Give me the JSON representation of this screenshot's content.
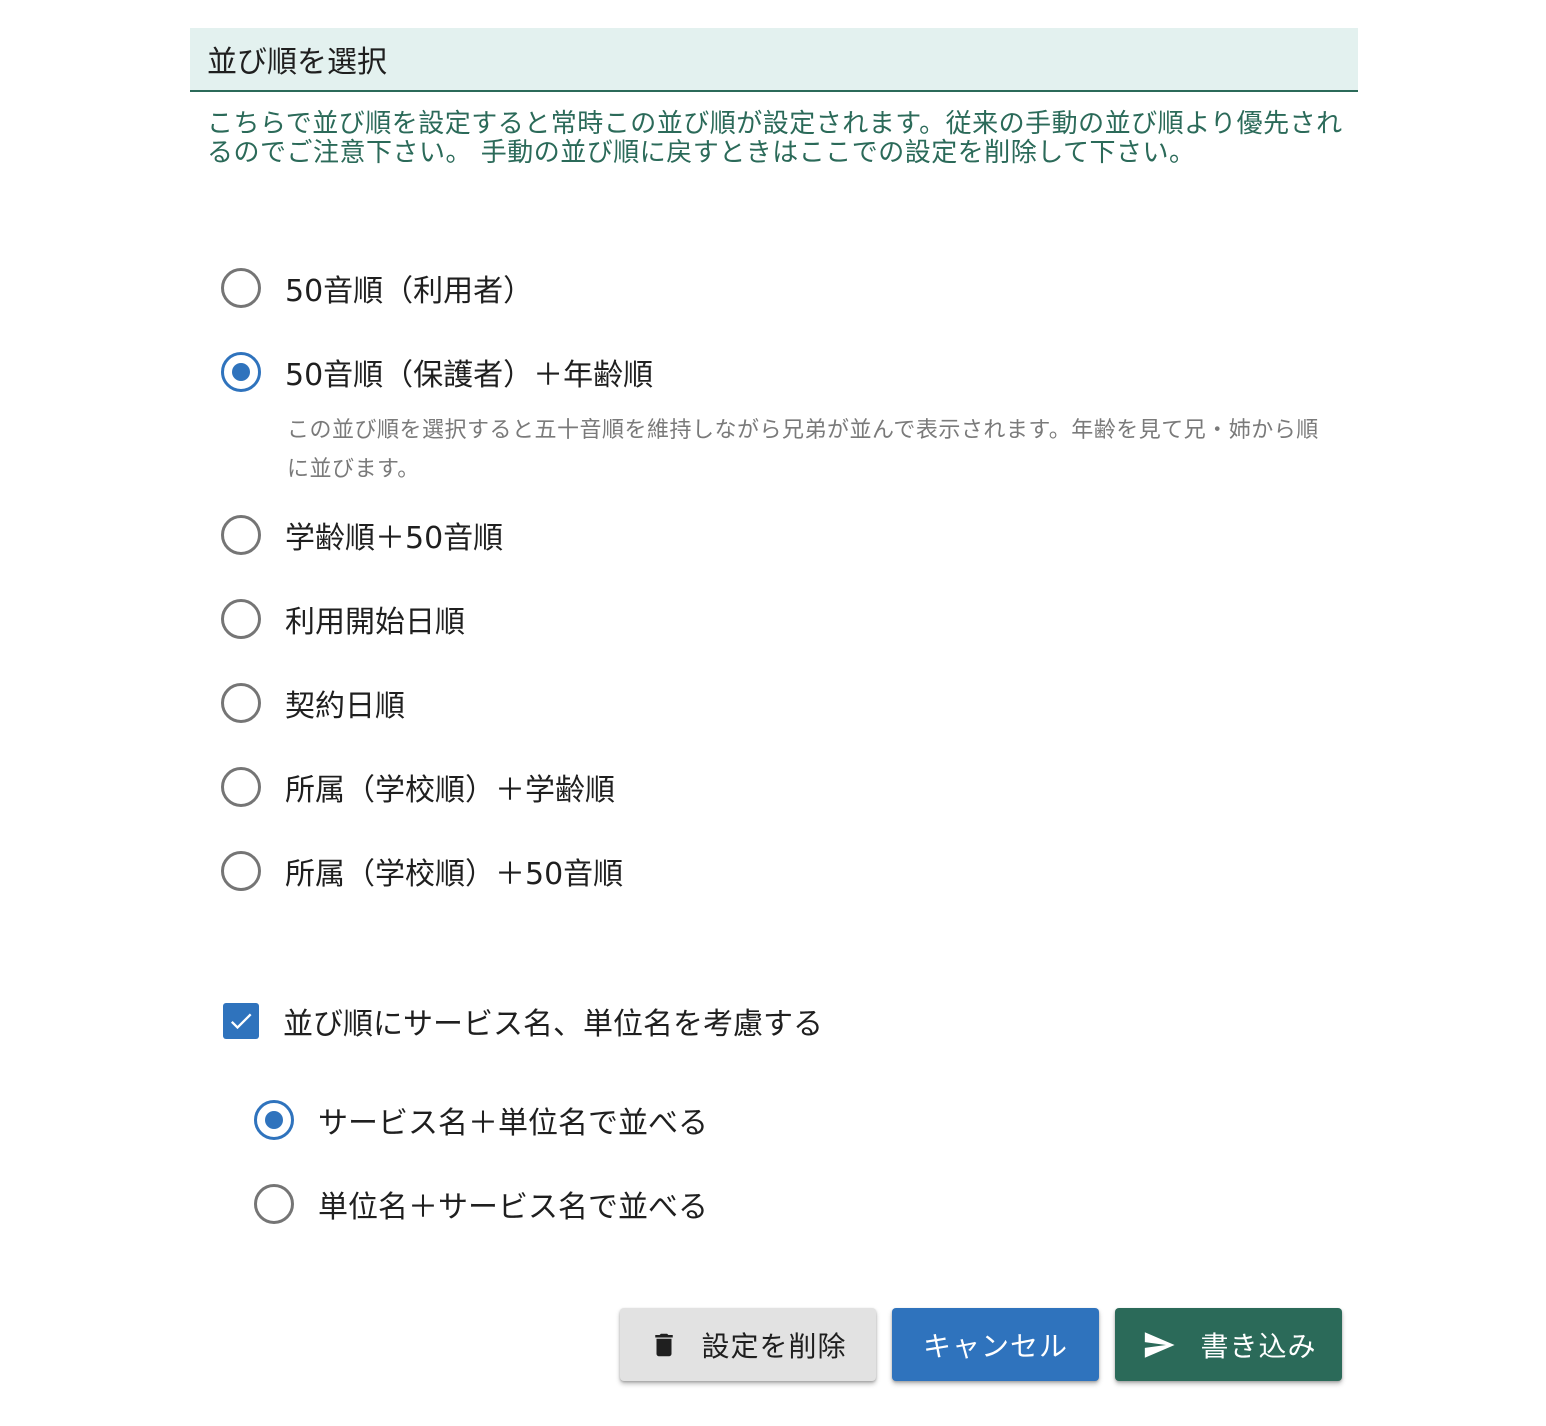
{
  "header": {
    "title": "並び順を選択"
  },
  "notice": {
    "text": "こちらで並び順を設定すると常時この並び順が設定されます。従来の手動の並び順より優先されるのでご注意下さい。 手動の並び順に戻すときはここでの設定を削除して下さい。"
  },
  "sort_options": [
    {
      "label": "50音順（利用者）",
      "checked": false
    },
    {
      "label": "50音順（保護者）＋年齢順",
      "checked": true,
      "hint": "この並び順を選択すると五十音順を維持しながら兄弟が並んで表示されます。年齢を見て兄・姉から順に並びます。"
    },
    {
      "label": "学齢順＋50音順",
      "checked": false
    },
    {
      "label": "利用開始日順",
      "checked": false
    },
    {
      "label": "契約日順",
      "checked": false
    },
    {
      "label": "所属（学校順）＋学齢順",
      "checked": false
    },
    {
      "label": "所属（学校順）＋50音順",
      "checked": false
    }
  ],
  "service_option": {
    "label": "並び順にサービス名、単位名を考慮する",
    "checked": true,
    "sub_options": [
      {
        "label": "サービス名＋単位名で並べる",
        "checked": true
      },
      {
        "label": "単位名＋サービス名で並べる",
        "checked": false
      }
    ]
  },
  "buttons": {
    "delete_label": "設定を削除",
    "cancel_label": "キャンセル",
    "save_label": "書き込み"
  },
  "colors": {
    "accent_green": "#2b6a59",
    "accent_blue": "#2f73bd",
    "header_bg": "#e3f1ef"
  },
  "icons": {
    "delete": "trash-icon",
    "save": "send-icon",
    "check": "check-icon"
  }
}
